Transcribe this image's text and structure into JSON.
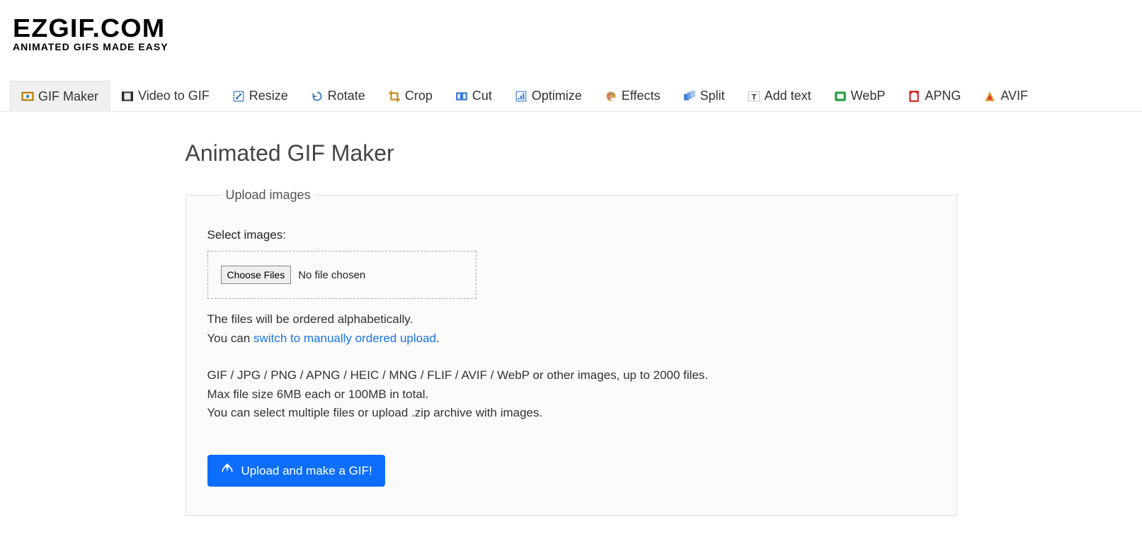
{
  "logo": {
    "main": "EZGIF.COM",
    "sub": "ANIMATED GIFS MADE EASY"
  },
  "nav": {
    "items": [
      {
        "label": "GIF Maker",
        "active": true
      },
      {
        "label": "Video to GIF",
        "active": false
      },
      {
        "label": "Resize",
        "active": false
      },
      {
        "label": "Rotate",
        "active": false
      },
      {
        "label": "Crop",
        "active": false
      },
      {
        "label": "Cut",
        "active": false
      },
      {
        "label": "Optimize",
        "active": false
      },
      {
        "label": "Effects",
        "active": false
      },
      {
        "label": "Split",
        "active": false
      },
      {
        "label": "Add text",
        "active": false
      },
      {
        "label": "WebP",
        "active": false
      },
      {
        "label": "APNG",
        "active": false
      },
      {
        "label": "AVIF",
        "active": false
      }
    ]
  },
  "page": {
    "title": "Animated GIF Maker"
  },
  "upload": {
    "legend": "Upload images",
    "select_label": "Select images:",
    "choose_button": "Choose Files",
    "file_status": "No file chosen",
    "info_line1": "The files will be ordered alphabetically.",
    "info_line2_prefix": "You can ",
    "info_line2_link": "switch to manually ordered upload",
    "info_line2_suffix": ".",
    "formats_line": "GIF / JPG / PNG / APNG / HEIC / MNG / FLIF / AVIF / WebP or other images, up to 2000 files.",
    "max_line": "Max file size 6MB each or 100MB in total.",
    "multi_line": "You can select multiple files or upload .zip archive with images.",
    "submit": "Upload and make a GIF!"
  }
}
